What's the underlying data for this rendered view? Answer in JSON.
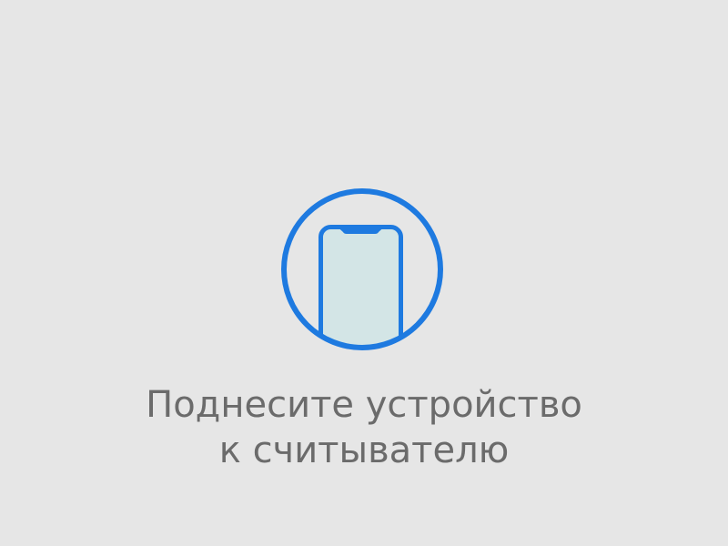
{
  "illustration": {
    "icon": "phone-tap-icon",
    "ring_color": "#1e7ae0",
    "phone_outline_color": "#1e7ae0",
    "screen_fill_color": "#d3e5e6"
  },
  "prompt": {
    "line1": "Поднесите устройство",
    "line2": "к считывателю"
  }
}
